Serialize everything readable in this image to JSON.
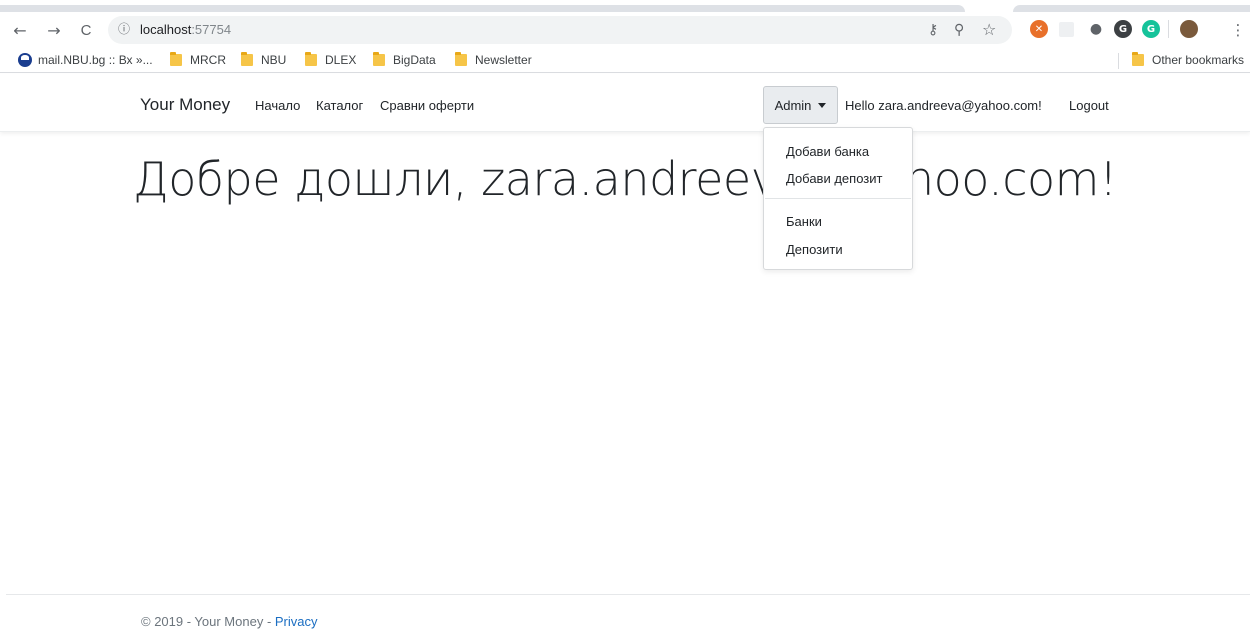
{
  "browser": {
    "url_host": "localhost",
    "url_port": ":57754",
    "bookmarks": [
      {
        "label": "mail.NBU.bg :: Вх »...",
        "icon": "nbu-logo-icon"
      },
      {
        "label": "MRCR",
        "icon": "folder-icon"
      },
      {
        "label": "NBU",
        "icon": "folder-icon"
      },
      {
        "label": "DLEX",
        "icon": "folder-icon"
      },
      {
        "label": "BigData",
        "icon": "folder-icon"
      },
      {
        "label": "Newsletter",
        "icon": "folder-icon"
      }
    ],
    "other_bookmarks": "Other bookmarks",
    "glyphs": {
      "back": "←",
      "forward": "→",
      "reload": "C",
      "info": "ⓘ",
      "key": "⚷",
      "zoom": "⚲",
      "star": "☆",
      "menu": "⋮"
    },
    "colors": {
      "tab": "#dee1e6",
      "omnibox": "#f1f3f4",
      "folder": "#f6c548"
    }
  },
  "navbar": {
    "brand": "Your Money",
    "links": [
      "Начало",
      "Каталог",
      "Сравни оферти"
    ],
    "admin_label": "Admin",
    "greeting": "Hello zara.andreeva@yahoo.com!",
    "logout": "Logout"
  },
  "dropdown": {
    "items": [
      "Добави банка",
      "Добави депозит",
      "Банки",
      "Депозити"
    ]
  },
  "main": {
    "welcome": "Добре дошли, zara.andreeva@yahoo.com!"
  },
  "footer": {
    "text": "© 2019 - Your Money - ",
    "privacy": "Privacy",
    "link_color": "#1b6ec2"
  }
}
